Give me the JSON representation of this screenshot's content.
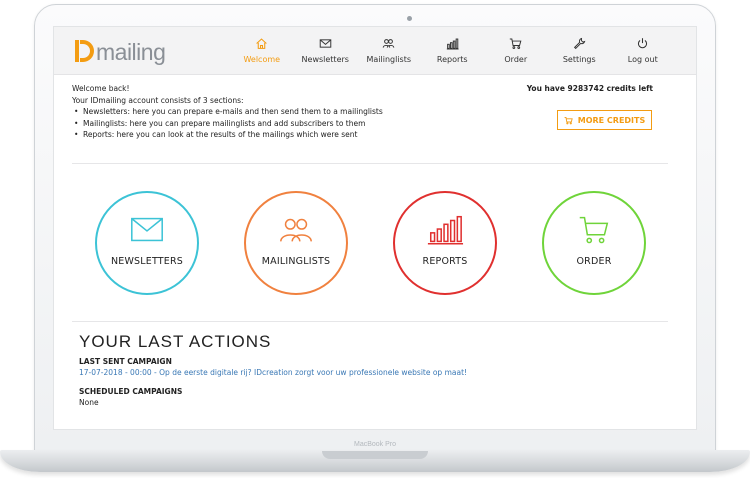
{
  "device": {
    "brand": "MacBook Pro"
  },
  "logo": {
    "text": "mailing"
  },
  "nav": [
    {
      "label": "Welcome",
      "icon": "home-icon",
      "active": true
    },
    {
      "label": "Newsletters",
      "icon": "envelope-icon",
      "active": false
    },
    {
      "label": "Mailinglists",
      "icon": "users-icon",
      "active": false
    },
    {
      "label": "Reports",
      "icon": "bar-chart-icon",
      "active": false
    },
    {
      "label": "Order",
      "icon": "cart-icon",
      "active": false
    },
    {
      "label": "Settings",
      "icon": "wrench-icon",
      "active": false
    },
    {
      "label": "Log out",
      "icon": "power-icon",
      "active": false
    }
  ],
  "welcome": {
    "greeting": "Welcome back!",
    "intro": "Your IDmailing account consists of 3 sections:",
    "items": [
      "Newsletters: here you can prepare e-mails and then send them to a mailinglists",
      "Mailinglists: here you can prepare mailinglists and add subscribers to them",
      "Reports: here you can look at the results of the mailings which were sent"
    ]
  },
  "credits": {
    "text": "You have 9283742 credits left",
    "button": "MORE CREDITS"
  },
  "tiles": [
    {
      "label": "NEWSLETTERS",
      "icon": "envelope-icon",
      "color": "#3cc3d6"
    },
    {
      "label": "MAILINGLISTS",
      "icon": "users-icon",
      "color": "#f0813f"
    },
    {
      "label": "REPORTS",
      "icon": "bar-chart-icon",
      "color": "#e0302f"
    },
    {
      "label": "ORDER",
      "icon": "cart-icon",
      "color": "#6fd43a"
    }
  ],
  "actions": {
    "title": "YOUR LAST ACTIONS",
    "last_sent_label": "LAST SENT CAMPAIGN",
    "last_sent_value": "17-07-2018 - 00:00 - Op de eerste digitale rij? IDcreation zorgt voor uw professionele website op maat!",
    "scheduled_label": "SCHEDULED CAMPAIGNS",
    "scheduled_value": "None"
  },
  "colors": {
    "accent": "#f39c12",
    "link": "#3a78b5"
  }
}
